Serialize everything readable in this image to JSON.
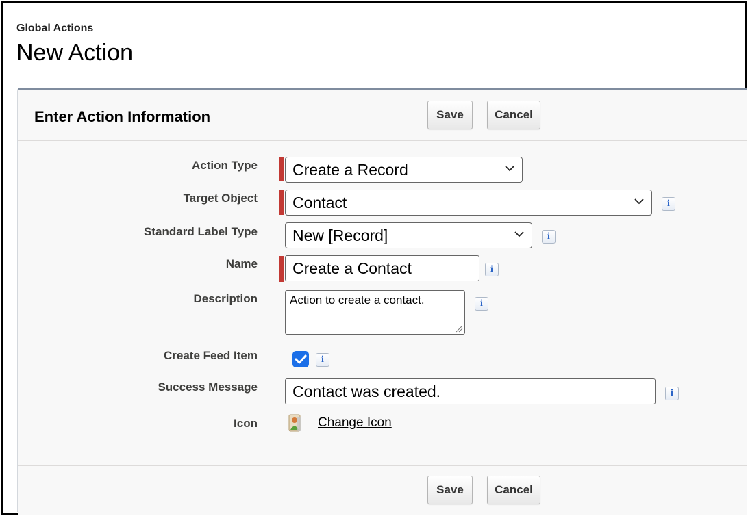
{
  "header": {
    "subtitle": "Global Actions",
    "title": "New Action"
  },
  "panel": {
    "title": "Enter Action Information",
    "save_label": "Save",
    "cancel_label": "Cancel"
  },
  "form": {
    "action_type": {
      "label": "Action Type",
      "value": "Create a Record",
      "required": true
    },
    "target_object": {
      "label": "Target Object",
      "value": "Contact",
      "required": true
    },
    "standard_label_type": {
      "label": "Standard Label Type",
      "value": "New [Record]",
      "required": false
    },
    "name": {
      "label": "Name",
      "value": "Create a Contact",
      "required": true
    },
    "description": {
      "label": "Description",
      "value": "Action to create a contact.",
      "required": false
    },
    "create_feed_item": {
      "label": "Create Feed Item",
      "checked": true
    },
    "success_message": {
      "label": "Success Message",
      "value": "Contact was created."
    },
    "icon": {
      "label": "Icon",
      "link_label": "Change Icon",
      "icon_name": "contact-card-icon"
    }
  },
  "info_glyph": "i",
  "colors": {
    "required_bar": "#c23934",
    "checkbox": "#1b6fe8",
    "panel_top_border": "#7f8c9e"
  }
}
